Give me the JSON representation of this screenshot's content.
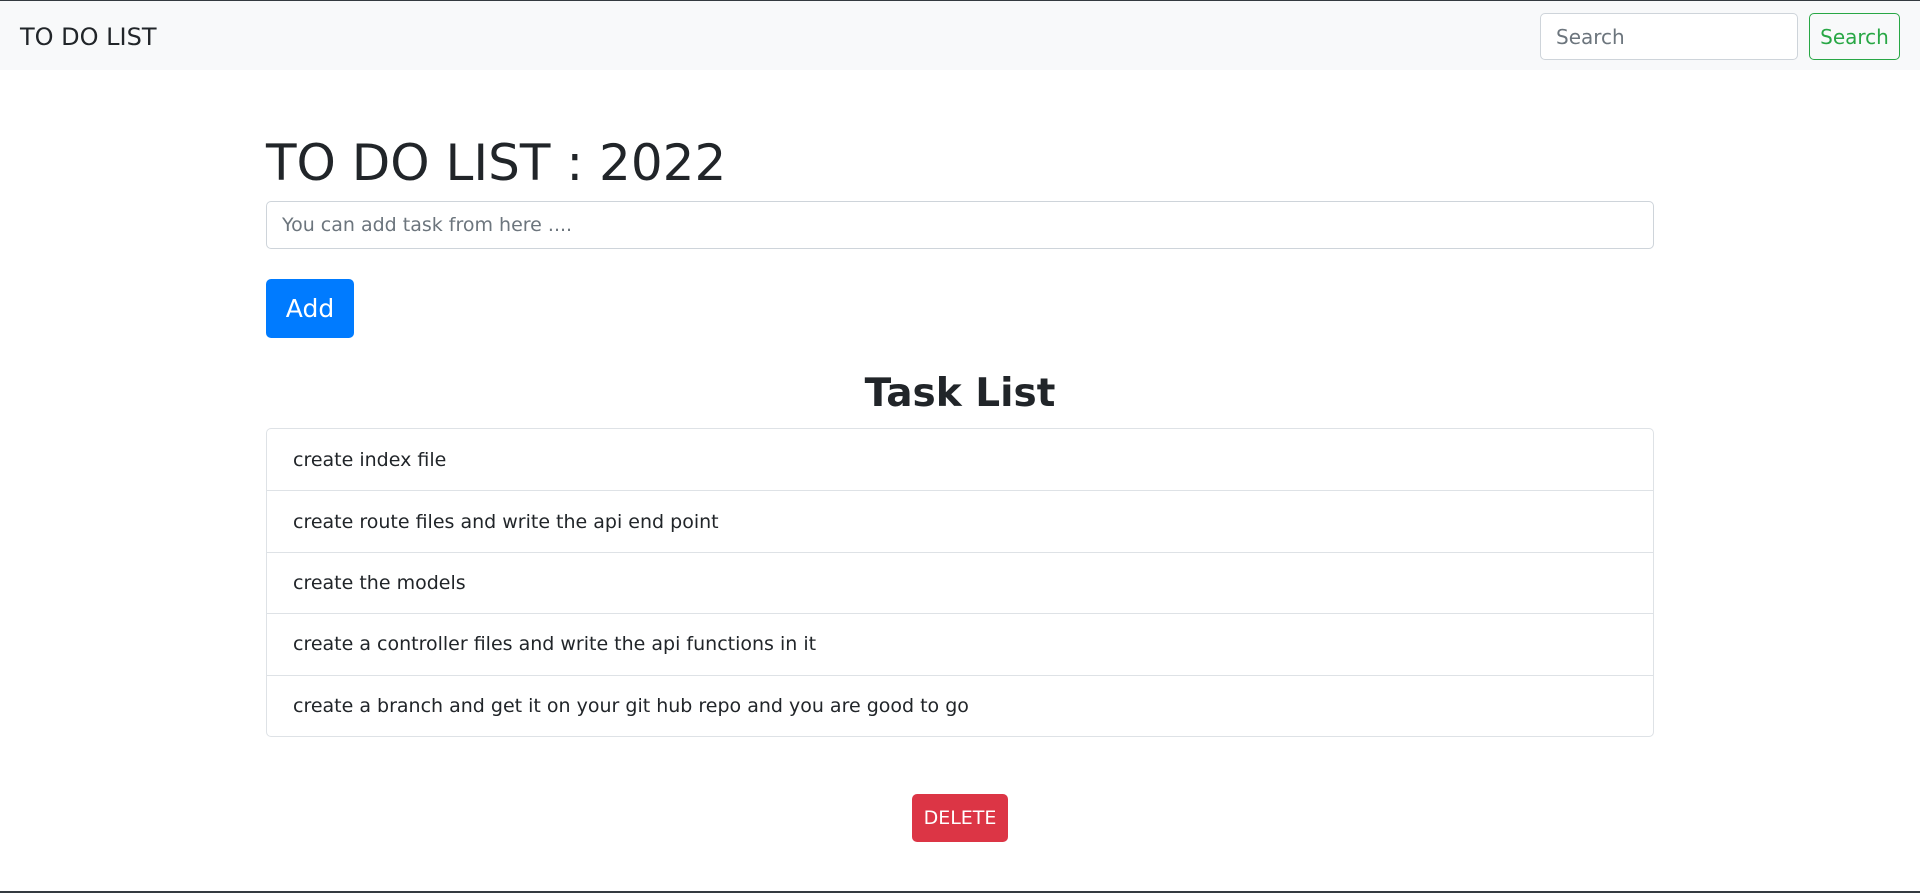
{
  "navbar": {
    "brand": "TO DO LIST",
    "search_placeholder": "Search",
    "search_button": "Search"
  },
  "main": {
    "title": "TO DO LIST : 2022",
    "task_input_placeholder": "You can add task from here ....",
    "add_button": "Add",
    "list_title": "Task List",
    "tasks": [
      "create index file",
      "create route files and write the api end point",
      "create the models",
      "create a controller files and write the api functions in it",
      "create a branch and get it on your git hub repo and you are good to go"
    ],
    "delete_button": "DELETE"
  },
  "colors": {
    "navbar_bg": "#f8f9fa",
    "add_button": "#007bff",
    "search_button": "#28a745",
    "delete_button": "#dc3545"
  }
}
